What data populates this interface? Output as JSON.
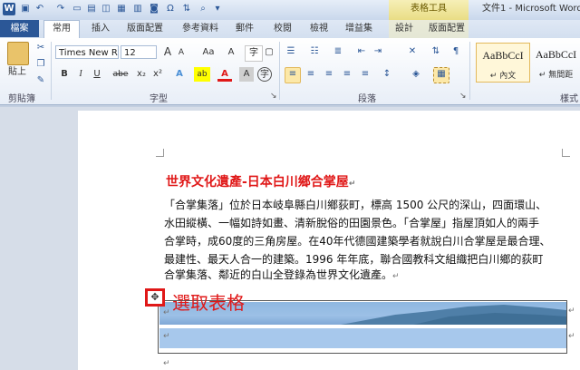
{
  "titlebar": {
    "app_icon": "W",
    "quick_access": [
      "save-icon",
      "undo-icon",
      "redo-icon",
      "new-doc-icon",
      "open-icon",
      "print-preview-icon",
      "table-icon",
      "paste-icon",
      "camera-icon",
      "omega-icon",
      "sort-icon",
      "search-icon",
      "customize-icon"
    ],
    "context_group": "表格工具",
    "doc_title": "文件1 - Microsoft Word"
  },
  "tabs": [
    {
      "label": "檔案"
    },
    {
      "label": "常用"
    },
    {
      "label": "插入"
    },
    {
      "label": "版面配置"
    },
    {
      "label": "參考資料"
    },
    {
      "label": "郵件"
    },
    {
      "label": "校閱"
    },
    {
      "label": "檢視"
    },
    {
      "label": "增益集"
    },
    {
      "label": "設計"
    },
    {
      "label": "版面配置"
    }
  ],
  "ribbon": {
    "clipboard": {
      "paste_label": "貼上",
      "group_label": "剪貼簿"
    },
    "font": {
      "font_name": "Times New R",
      "font_size": "12",
      "group_label": "字型",
      "grow": "A",
      "shrink": "A",
      "case": "Aa",
      "clear": "A",
      "bold": "B",
      "italic": "I",
      "underline": "U",
      "strike": "abe",
      "sub": "x₂",
      "sup": "x²",
      "effect": "A",
      "highlight": "ab",
      "color": "A",
      "char_shade": "A",
      "enclose": "字"
    },
    "paragraph": {
      "group_label": "段落"
    },
    "styles": {
      "normal_sample": "AaBbCcI",
      "normal_name": "↵ 內文",
      "nospacing_sample": "AaBbCcI",
      "nospacing_name": "↵ 無間距",
      "group_label": "樣式"
    },
    "colors": {
      "accent": "#2b5797",
      "highlight": "#ffff00",
      "font_color": "#e01818"
    }
  },
  "document": {
    "heading": "世界文化遺產-日本白川鄉合掌屋",
    "paragraph_lines": [
      "「合掌集落」位於日本岐阜縣白川鄉荻町，標高 1500 公尺的深山，四面環山、",
      "水田縱橫、一幅如詩如畫、清新脫俗的田園景色。「合掌屋」指屋頂如人的兩手",
      "合掌時，成60度的三角房屋。在40年代德國建築學者就說白川合掌屋是最合理、",
      "最建性、最天人合一的建築。1996 年年底，聯合國教科文組織把白川鄉的荻町",
      "合掌集落、鄰近的白山全登錄為世界文化遺產。"
    ],
    "para_mark": "↵",
    "annotation": "選取表格",
    "table_handle_glyph": "✥"
  }
}
